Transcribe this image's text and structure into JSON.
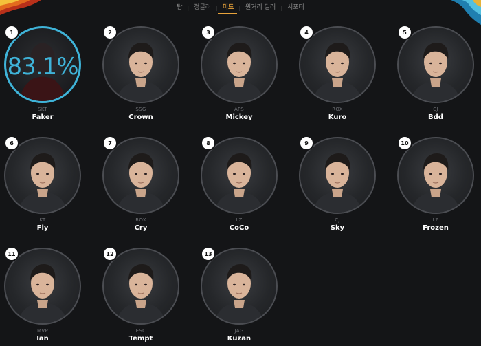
{
  "tabs": [
    {
      "label": "탑",
      "active": false
    },
    {
      "label": "정글러",
      "active": false
    },
    {
      "label": "미드",
      "active": true
    },
    {
      "label": "원거리 딜러",
      "active": false
    },
    {
      "label": "서포터",
      "active": false
    }
  ],
  "selected_percent": "83.1%",
  "colors": {
    "accent_tab": "#e8a33b",
    "selection_ring": "#3fb3d8",
    "background": "#141517"
  },
  "players": [
    {
      "rank": "1",
      "team": "SKT",
      "name": "Faker",
      "selected": true
    },
    {
      "rank": "2",
      "team": "SSG",
      "name": "Crown",
      "selected": false
    },
    {
      "rank": "3",
      "team": "AFS",
      "name": "Mickey",
      "selected": false
    },
    {
      "rank": "4",
      "team": "ROX",
      "name": "Kuro",
      "selected": false
    },
    {
      "rank": "5",
      "team": "CJ",
      "name": "Bdd",
      "selected": false
    },
    {
      "rank": "6",
      "team": "KT",
      "name": "Fly",
      "selected": false
    },
    {
      "rank": "7",
      "team": "ROX",
      "name": "Cry",
      "selected": false
    },
    {
      "rank": "8",
      "team": "LZ",
      "name": "CoCo",
      "selected": false
    },
    {
      "rank": "9",
      "team": "CJ",
      "name": "Sky",
      "selected": false
    },
    {
      "rank": "10",
      "team": "LZ",
      "name": "Frozen",
      "selected": false
    },
    {
      "rank": "11",
      "team": "MVP",
      "name": "Ian",
      "selected": false
    },
    {
      "rank": "12",
      "team": "ESC",
      "name": "Tempt",
      "selected": false
    },
    {
      "rank": "13",
      "team": "JAG",
      "name": "Kuzan",
      "selected": false
    }
  ]
}
